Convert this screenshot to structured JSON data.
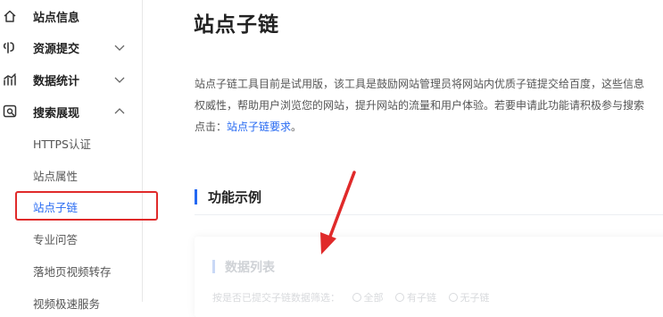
{
  "sidebar": {
    "items": [
      {
        "label": "站点信息",
        "icon": "home-icon"
      },
      {
        "label": "资源提交",
        "icon": "link-icon"
      },
      {
        "label": "数据统计",
        "icon": "chart-icon"
      },
      {
        "label": "搜索展现",
        "icon": "search-display-icon"
      }
    ],
    "sub_items": [
      {
        "label": "HTTPS认证"
      },
      {
        "label": "站点属性"
      },
      {
        "label": "站点子链"
      },
      {
        "label": "专业问答"
      },
      {
        "label": "落地页视频转存"
      },
      {
        "label": "视频极速服务"
      }
    ]
  },
  "main": {
    "title": "站点子链",
    "desc_line1": "站点子链工具目前是试用版，该工具是鼓励网站管理员将网站内优质子链提交给百度，这些信息",
    "desc_line2": "权威性，帮助用户浏览您的网站，提升网站的流量和用户体验。若要申请此功能请积极参与搜索",
    "desc_line3_prefix": "点击：",
    "desc_link": "站点子链要求",
    "desc_line3_suffix": "。",
    "section_title": "功能示例",
    "example": {
      "title": "数据列表",
      "filter_label": "按是否已提交子链数据筛选：",
      "options": [
        "全部",
        "有子链",
        "无子链"
      ]
    }
  },
  "colors": {
    "accent": "#2468f2",
    "highlight": "#e02a2a"
  }
}
